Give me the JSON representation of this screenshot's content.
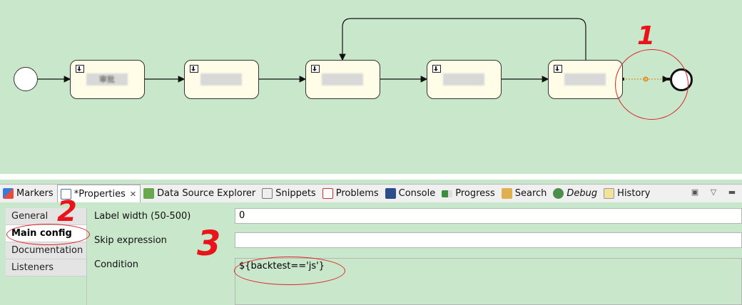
{
  "diagram": {
    "tasks": [
      {
        "label": "审批"
      },
      {
        "label": ""
      },
      {
        "label": ""
      },
      {
        "label": ""
      },
      {
        "label": ""
      }
    ]
  },
  "annotations": {
    "mark1": "1",
    "mark2": "2",
    "mark3": "3"
  },
  "tabs": [
    {
      "label": "Markers",
      "icon": "markers-icon"
    },
    {
      "label": "*Properties",
      "icon": "properties-icon",
      "active": true
    },
    {
      "label": "Data Source Explorer",
      "icon": "data-source-explorer-icon"
    },
    {
      "label": "Snippets",
      "icon": "snippets-icon"
    },
    {
      "label": "Problems",
      "icon": "problems-icon"
    },
    {
      "label": "Console",
      "icon": "console-icon"
    },
    {
      "label": "Progress",
      "icon": "progress-icon"
    },
    {
      "label": "Search",
      "icon": "search-icon"
    },
    {
      "label": "Debug",
      "icon": "debug-icon"
    },
    {
      "label": "History",
      "icon": "history-icon"
    }
  ],
  "sidebar": {
    "items": [
      {
        "label": "General"
      },
      {
        "label": "Main config"
      },
      {
        "label": "Documentation"
      },
      {
        "label": "Listeners"
      }
    ]
  },
  "form": {
    "label_width": {
      "label": "Label width (50-500)",
      "value": "0"
    },
    "skip_expression": {
      "label": "Skip expression",
      "value": ""
    },
    "condition": {
      "label": "Condition",
      "value": "${backtest=='js'}"
    }
  },
  "colors": {
    "canvas_bg": "#c9e7cb",
    "task_fill": "#fffde8",
    "annotation_red": "#e2232a",
    "selected_flow": "#e08a1e"
  }
}
